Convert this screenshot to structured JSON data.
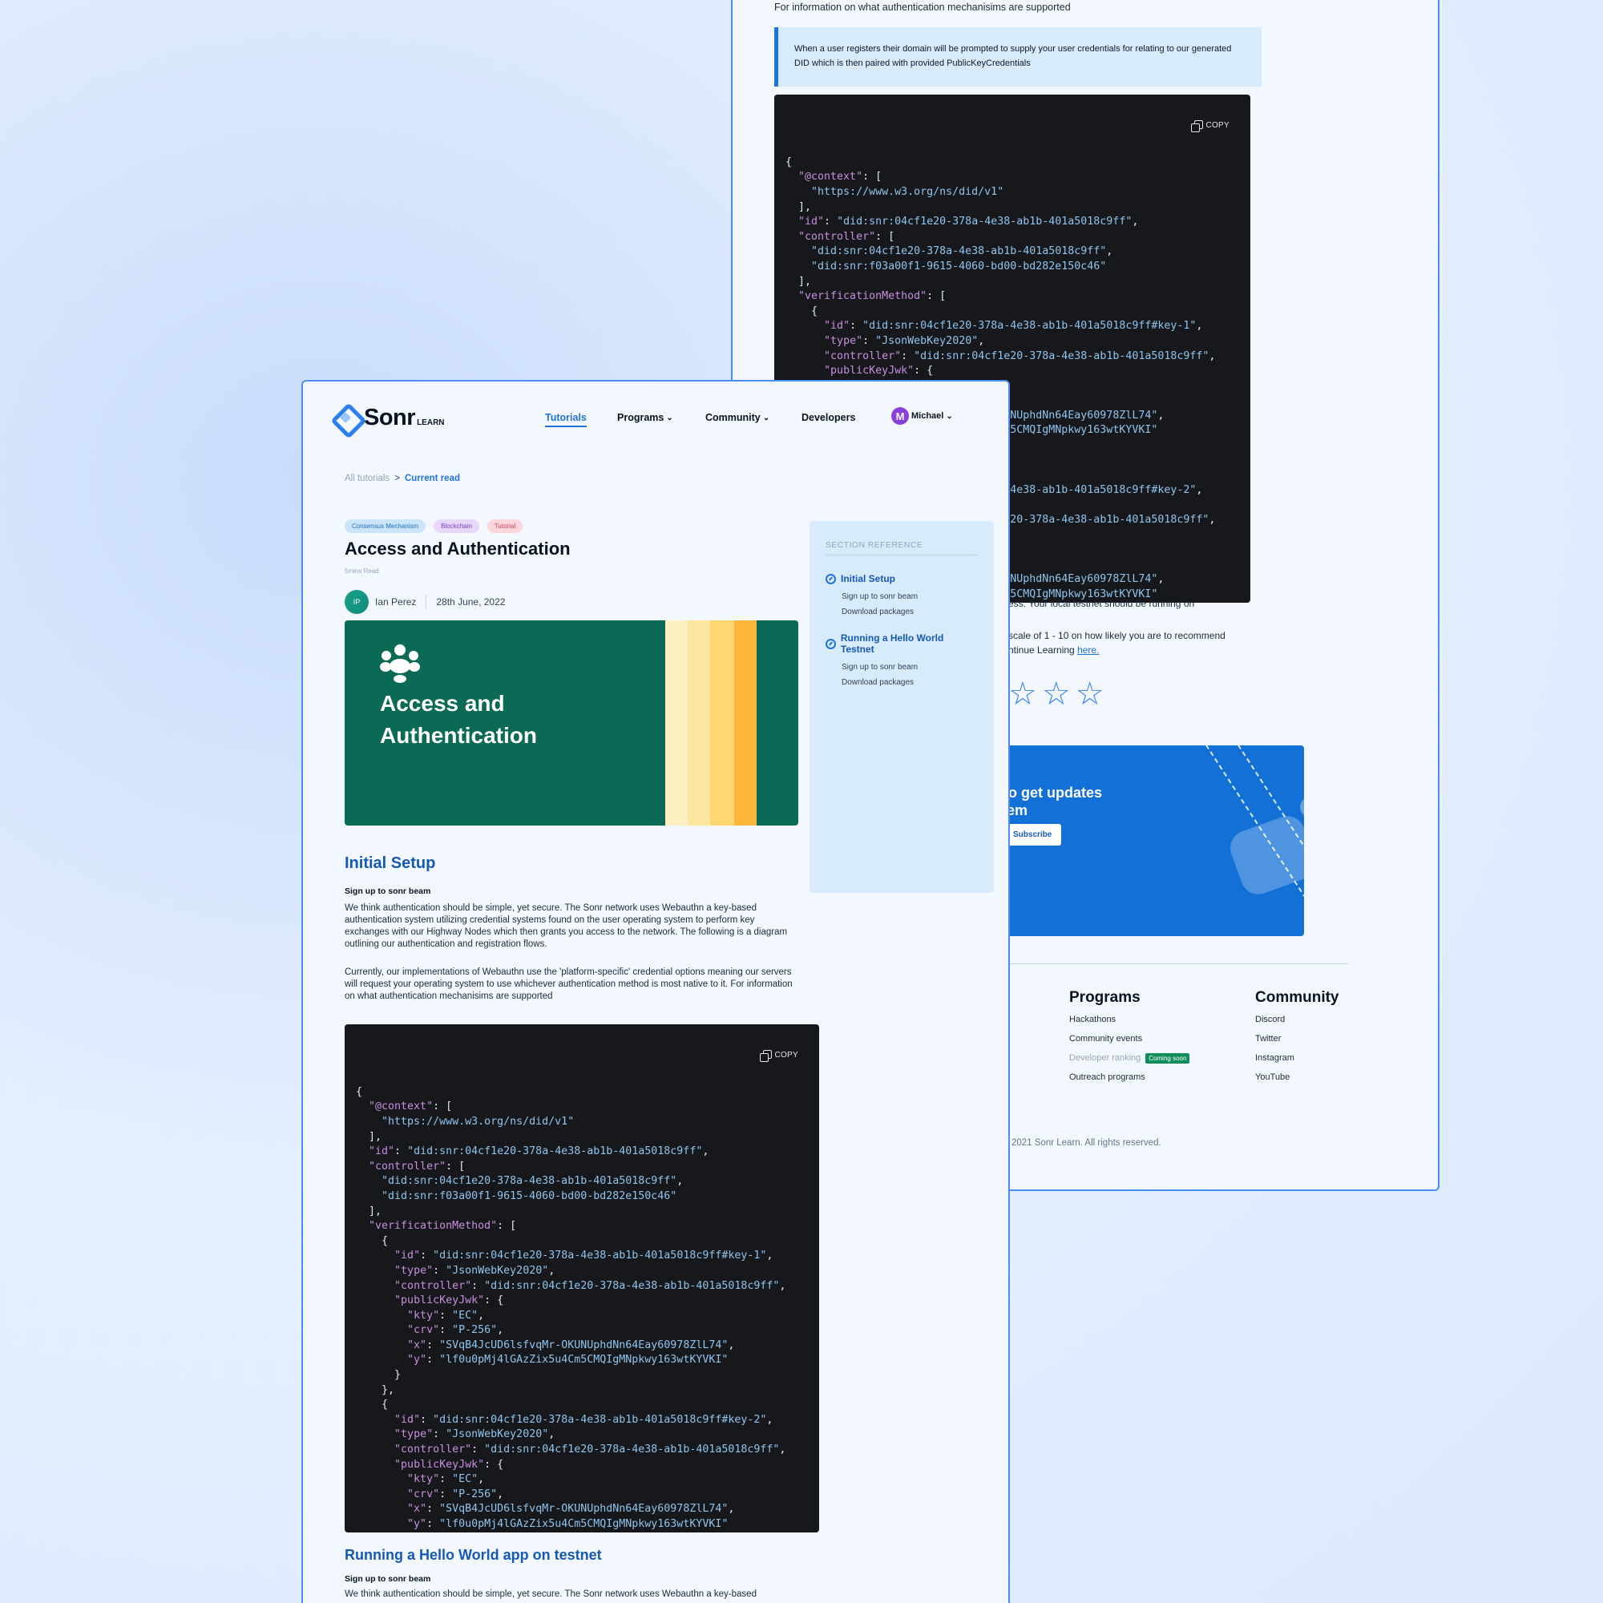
{
  "back": {
    "intro": "For information on what authentication mechanisims are supported",
    "callout": "When a user registers their domain will be prompted to supply your user credentials for relating to our generated DID which is then paired with provided PublicKeyCredentials",
    "copy_label": "COPY",
    "local_testnet_text": "ess. Your local testnet should be running on",
    "recommend_line1": "scale of 1 - 10 on how likely you are to recommend",
    "recommend_line2": "ntinue Learning",
    "recommend_link": "here.",
    "newsletter": {
      "title": "r to get updates stem",
      "title_line1": "r to get updates",
      "title_line2": "stem",
      "button": "Subscribe"
    },
    "footer": {
      "programs": {
        "title": "Programs",
        "items": [
          "Hackathons",
          "Community events",
          "Developer ranking",
          "Outreach programs"
        ],
        "badge": "Coming soon"
      },
      "community": {
        "title": "Community",
        "items": [
          "Discord",
          "Twitter",
          "Instagram",
          "YouTube"
        ]
      },
      "copyright": "2021 Sonr Learn. All rights reserved."
    }
  },
  "front": {
    "logo": {
      "name": "Sonr",
      "sub": "LEARN"
    },
    "nav": {
      "tutorials": "Tutorials",
      "programs": "Programs",
      "community": "Community",
      "developers": "Developers",
      "user_initial": "M",
      "user_name": "Michael"
    },
    "breadcrumb": {
      "all": "All tutorials",
      "sep": ">",
      "current": "Current read"
    },
    "tags": [
      "Consensus Mechanism",
      "Blockchain",
      "Tutorial"
    ],
    "title": "Access and Authentication",
    "read_time": "5mins Read",
    "author": {
      "initials": "IP",
      "name": "Ian Perez",
      "date": "28th June, 2022"
    },
    "hero": {
      "line1": "Access and",
      "line2": "Authentication"
    },
    "sidebar": {
      "heading": "SECTION REFERENCE",
      "groups": [
        {
          "title": "Initial Setup",
          "items": [
            "Sign up to sonr beam",
            "Download packages"
          ]
        },
        {
          "title": "Running a Hello World Testnet",
          "items": [
            "Sign up to sonr beam",
            "Download packages"
          ]
        }
      ]
    },
    "section1": {
      "title": "Initial Setup",
      "subtitle": "Sign up to sonr beam",
      "para1": "We think authentication should be simple, yet secure. The Sonr network uses Webauthn a key-based authentication system utilizing credential systems found on the user operating system to perform key exchanges with our Highway Nodes which then grants you access to the network. The following is a diagram outlining our authentication and registration flows.",
      "para2": "Currently, our implementations of Webauthn use the 'platform-specific' credential options meaning our servers will request your operating system to use whichever authentication method is most native to it. For information on what authentication mechanisims are supported"
    },
    "copy_label": "COPY",
    "section2": {
      "title": "Running a Hello World app on testnet",
      "subtitle": "Sign up to sonr beam",
      "para": "We think authentication should be simple, yet secure. The Sonr network uses Webauthn a key-based"
    }
  },
  "code_lines": [
    "{",
    "  \"@context\": [",
    "    \"https://www.w3.org/ns/did/v1\"",
    "  ],",
    "  \"id\": \"did:snr:04cf1e20-378a-4e38-ab1b-401a5018c9ff\",",
    "  \"controller\": [",
    "    \"did:snr:04cf1e20-378a-4e38-ab1b-401a5018c9ff\",",
    "    \"did:snr:f03a00f1-9615-4060-bd00-bd282e150c46\"",
    "  ],",
    "  \"verificationMethod\": [",
    "    {",
    "      \"id\": \"did:snr:04cf1e20-378a-4e38-ab1b-401a5018c9ff#key-1\",",
    "      \"type\": \"JsonWebKey2020\",",
    "      \"controller\": \"did:snr:04cf1e20-378a-4e38-ab1b-401a5018c9ff\",",
    "      \"publicKeyJwk\": {",
    "        \"kty\": \"EC\",",
    "        \"crv\": \"P-256\",",
    "        \"x\": \"SVqB4JcUD6lsfvqMr-OKUNUphdNn64Eay60978ZlL74\",",
    "        \"y\": \"lf0u0pMj4lGAzZix5u4Cm5CMQIgMNpkwy163wtKYVKI\"",
    "      }",
    "    },",
    "    {",
    "      \"id\": \"did:snr:04cf1e20-378a-4e38-ab1b-401a5018c9ff#key-2\",",
    "      \"type\": \"JsonWebKey2020\",",
    "      \"controller\": \"did:snr:04cf1e20-378a-4e38-ab1b-401a5018c9ff\",",
    "      \"publicKeyJwk\": {",
    "        \"kty\": \"EC\",",
    "        \"crv\": \"P-256\",",
    "        \"x\": \"SVqB4JcUD6lsfvqMr-OKUNUphdNn64Eay60978ZlL74\",",
    "        \"y\": \"lf0u0pMj4lGAzZix5u4Cm5CMQIgMNpkwy163wtKYVKI\"",
    "      }",
    "    }"
  ],
  "colors": {
    "accent": "#1f74d8",
    "hero_green": "#0b6a55",
    "code_bg": "#17181c",
    "newsletter_bg": "#1370d6"
  },
  "icons": [
    "copy-icon",
    "link-icon",
    "star-icon",
    "chevron-down-icon",
    "sonr-logo-icon",
    "people-icon"
  ],
  "rating": {
    "max_visible": 3
  }
}
